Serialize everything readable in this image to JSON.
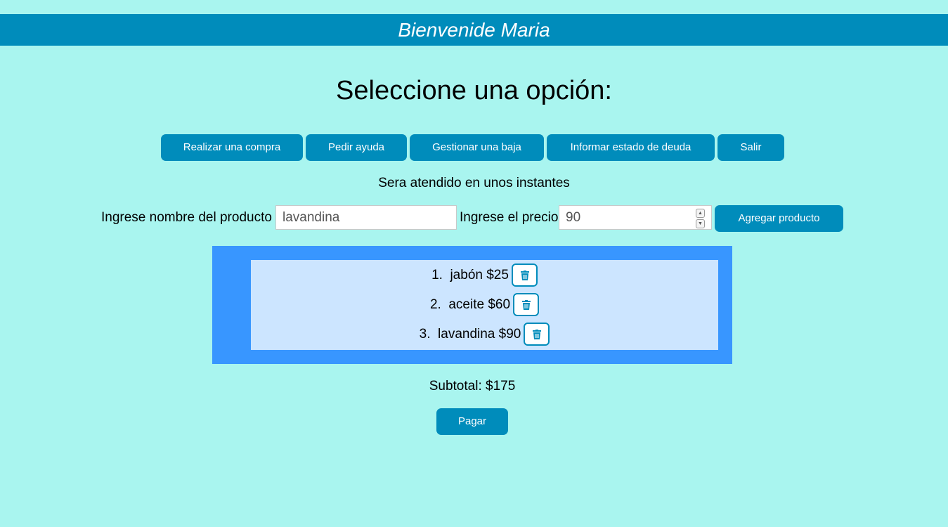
{
  "header": {
    "welcome": "Bienvenide Maria"
  },
  "title": "Seleccione una opción:",
  "menu": {
    "buy": "Realizar una compra",
    "help": "Pedir ayuda",
    "cancel": "Gestionar una baja",
    "debt": "Informar estado de deuda",
    "exit": "Salir"
  },
  "status": "Sera atendido en unos instantes",
  "form": {
    "product_label": "Ingrese nombre del producto",
    "product_value": "lavandina",
    "price_label": "Ingrese el precio",
    "price_value": "90",
    "add_button": "Agregar producto"
  },
  "cart": {
    "items": [
      {
        "label": "1.  jabón $25"
      },
      {
        "label": "2.  aceite $60"
      },
      {
        "label": "3.  lavandina $90"
      }
    ]
  },
  "subtotal": "Subtotal: $175",
  "pay_button": "Pagar",
  "colors": {
    "background": "#a9f5ef",
    "primary": "#008cbb",
    "list_outer": "#3896ff",
    "list_inner": "#cce5ff"
  },
  "icons": {
    "delete": "trash-icon",
    "spinner_up": "chevron-up-icon",
    "spinner_down": "chevron-down-icon"
  }
}
